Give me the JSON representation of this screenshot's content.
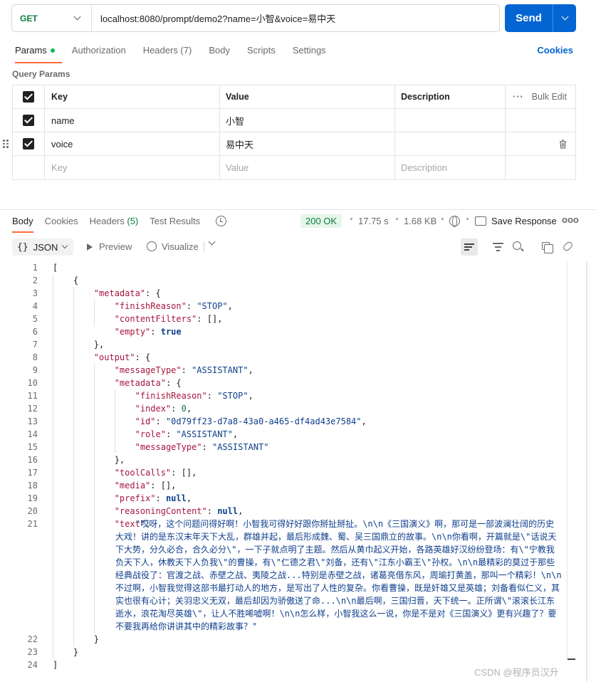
{
  "request": {
    "method": "GET",
    "url": "localhost:8080/prompt/demo2?name=小智&voice=易中天",
    "send_label": "Send"
  },
  "request_tabs": [
    "Params",
    "Authorization",
    "Headers (7)",
    "Body",
    "Scripts",
    "Settings"
  ],
  "cookies_label": "Cookies",
  "query_params_title": "Query Params",
  "params_table": {
    "headers": {
      "key": "Key",
      "value": "Value",
      "description": "Description",
      "bulk_edit": "Bulk Edit"
    },
    "rows": [
      {
        "key": "name",
        "value": "小智",
        "checked": true
      },
      {
        "key": "voice",
        "value": "易中天",
        "checked": true
      }
    ],
    "placeholder": {
      "key": "Key",
      "value": "Value",
      "description": "Description"
    }
  },
  "response_tabs": {
    "body": "Body",
    "cookies": "Cookies",
    "headers": "Headers",
    "headers_count": "(5)",
    "test_results": "Test Results"
  },
  "response_meta": {
    "status": "200 OK",
    "time": "17.75 s",
    "size": "1.68 KB",
    "save_response": "Save Response"
  },
  "response_toolbar": {
    "format": "JSON",
    "preview": "Preview",
    "visualize": "Visualize"
  },
  "code": {
    "text_value": "\"哎呀，这个问题问得好啊！小智我可得好好跟你掰扯掰扯。\\n\\n《三国演义》啊，那可是一部波澜壮阔的历史大戏！讲的是东汉末年天下大乱，群雄并起，最后形成魏、蜀、吴三国鼎立的故事。\\n\\n你看啊，开篇就是\\\"话说天下大势，分久必合，合久必分\\\"，一下子就点明了主题。然后从黄巾起义开始，各路英雄好汉纷纷登场：有\\\"宁教我负天下人，休教天下人负我\\\"的曹操，有\\\"仁德之君\\\"刘备，还有\\\"江东小霸王\\\"孙权。\\n\\n最精彩的莫过于那些经典战役了：官渡之战、赤壁之战、夷陵之战...特别是赤壁之战，诸葛亮借东风，周瑜打黄盖，那叫一个精彩！\\n\\n不过啊，小智我觉得这部书最打动人的地方，是写出了人性的复杂。你看曹操，既是奸雄又是英雄；刘备看似仁义，其实也很有心计；关羽忠义无双，最后却因为骄傲送了命...\\n\\n最后啊，三国归晋，天下统一。正所谓\\\"滚滚长江东逝水，浪花淘尽英雄\\\"，让人不胜唏嘘啊！\\n\\n怎么样，小智我这么一说，你是不是对《三国演义》更有兴趣了？要不要我再给你讲讲其中的精彩故事？\"",
    "id": "\"0d79ff23-d7a8-43a0-a465-df4ad43e7584\""
  },
  "watermark": "CSDN @程序员汉升"
}
